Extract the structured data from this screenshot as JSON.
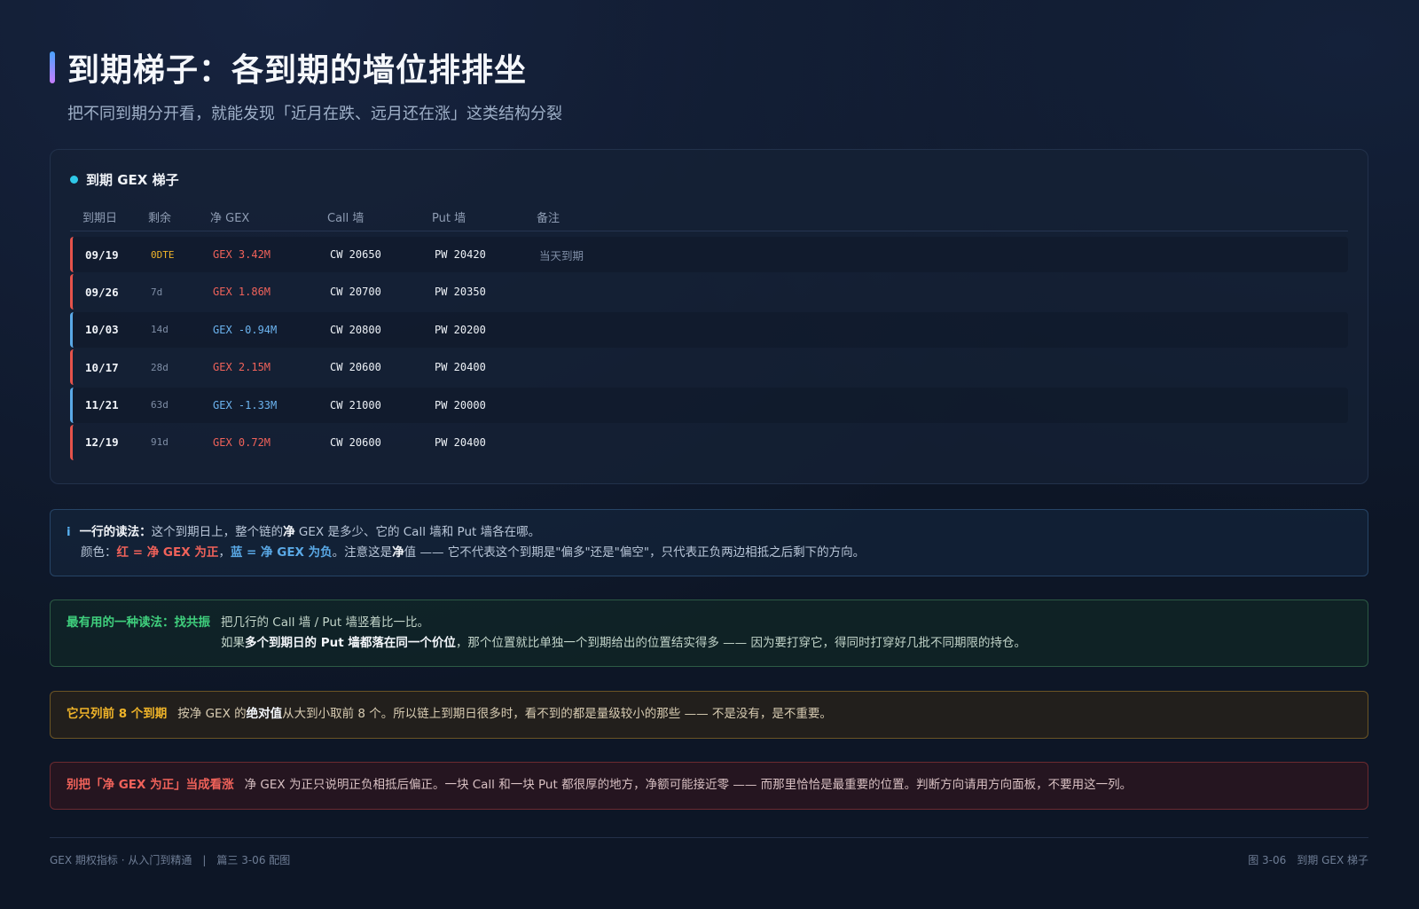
{
  "header": {
    "title": "到期梯子：各到期的墙位排排坐",
    "subtitle": "把不同到期分开看，就能发现「近月在跌、远月还在涨」这类结构分裂"
  },
  "table": {
    "title": "到期 GEX 梯子",
    "columns": [
      "到期日",
      "剩余",
      "净 GEX",
      "Call 墙",
      "Put 墙",
      "备注"
    ],
    "rows": [
      {
        "date": "09/19",
        "remain": "0DTE",
        "gex": "GEX 3.42M",
        "call": "CW 20650",
        "put": "PW 20420",
        "note": "当天到期"
      },
      {
        "date": "09/26",
        "remain": "7d",
        "gex": "GEX 1.86M",
        "call": "CW 20700",
        "put": "PW 20350",
        "note": ""
      },
      {
        "date": "10/03",
        "remain": "14d",
        "gex": "GEX -0.94M",
        "call": "CW 20800",
        "put": "PW 20200",
        "note": ""
      },
      {
        "date": "10/17",
        "remain": "28d",
        "gex": "GEX 2.15M",
        "call": "CW 20600",
        "put": "PW 20400",
        "note": ""
      },
      {
        "date": "11/21",
        "remain": "63d",
        "gex": "GEX -1.33M",
        "call": "CW 21000",
        "put": "PW 20000",
        "note": ""
      },
      {
        "date": "12/19",
        "remain": "91d",
        "gex": "GEX 0.72M",
        "call": "CW 20600",
        "put": "PW 20400",
        "note": ""
      }
    ]
  },
  "info": {
    "icon": "i",
    "l1_label": "一行的读法：",
    "l1_a": "这个到期日上，整个链的",
    "l1_b": "净",
    "l1_c": " GEX 是多少、它的 Call 墙和 Put 墙各在哪。",
    "l2_a": "颜色：",
    "l2_red": "红 = 净 GEX 为正",
    "l2_sep": "，",
    "l2_blue": "蓝 = 净 GEX 为负",
    "l2_b": "。注意这是",
    "l2_c": "净",
    "l2_d": "值 —— 它不代表这个到期是\"偏多\"还是\"偏空\"，只代表正负两边相抵之后剩下的方向。"
  },
  "green": {
    "label": "最有用的一种读法：找共振",
    "l1": "把几行的 Call 墙 / Put 墙竖着比一比。",
    "l2_a": "如果",
    "l2_b": "多个到期日的 Put 墙都落在同一个价位",
    "l2_c": "，那个位置就比单独一个到期给出的位置结实得多 —— 因为要打穿它，得同时打穿好几批不同期限的持仓。"
  },
  "yellow": {
    "label": "它只列前 8 个到期",
    "a": "按净 GEX 的",
    "b": "绝对值",
    "c": "从大到小取前 8 个。所以链上到期日很多时，看不到的都是量级较小的那些 —— 不是没有，是不重要。"
  },
  "red": {
    "label": "别把「净 GEX 为正」当成看涨",
    "text": "净 GEX 为正只说明正负相抵后偏正。一块 Call 和一块 Put 都很厚的地方，净额可能接近零 —— 而那里恰恰是最重要的位置。判断方向请用方向面板，不要用这一列。"
  },
  "footer": {
    "left": "GEX 期权指标 · 从入门到精通　|　篇三 3-06 配图",
    "right": "图 3-06　到期 GEX 梯子"
  },
  "colors": {
    "positive": "#f0625a",
    "negative": "#5aa9e6",
    "accent": "#2fc8e8"
  }
}
